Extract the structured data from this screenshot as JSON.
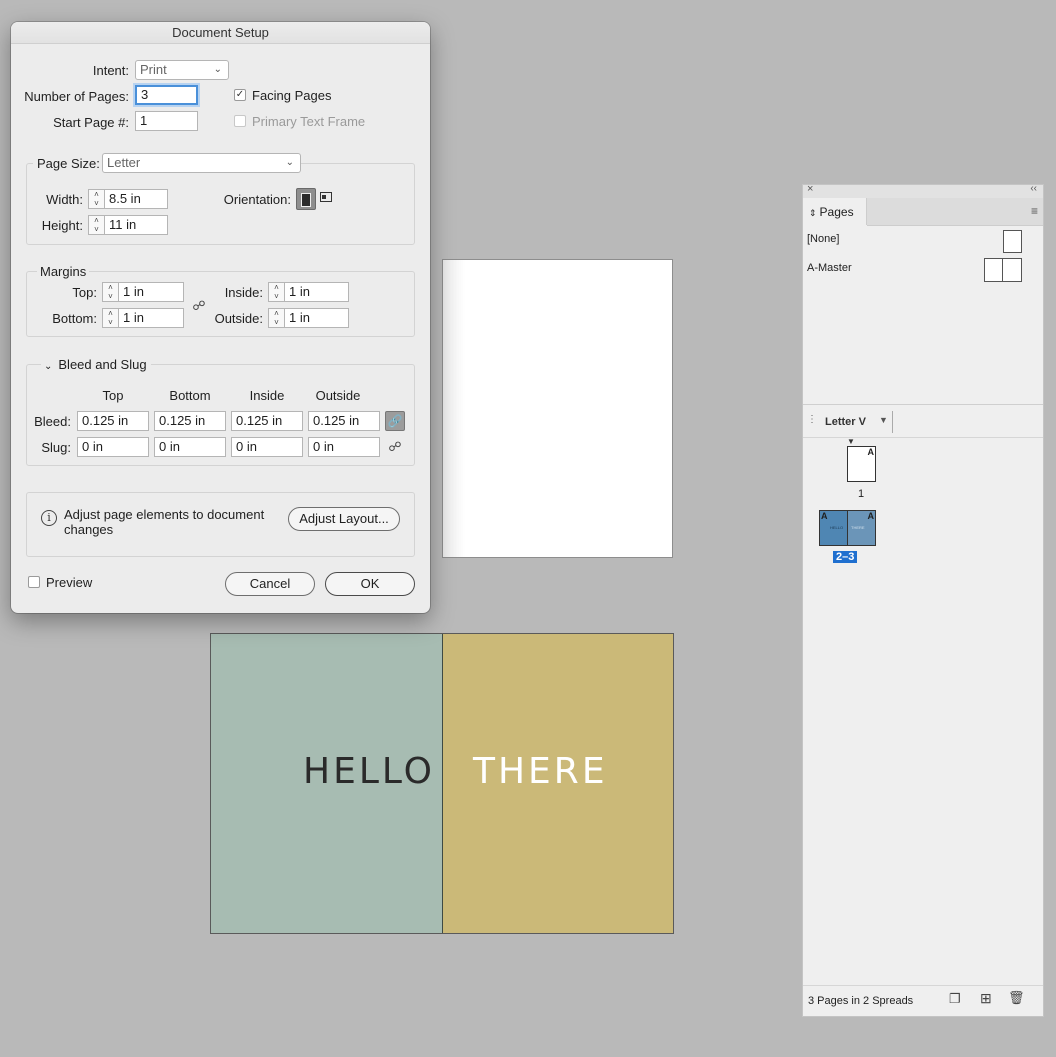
{
  "dialog": {
    "title": "Document Setup",
    "intent_label": "Intent:",
    "intent_value": "Print",
    "num_pages_label": "Number of Pages:",
    "num_pages_value": "3",
    "start_page_label": "Start Page #:",
    "start_page_value": "1",
    "facing_pages_label": "Facing Pages",
    "facing_pages_checked": true,
    "primary_text_frame_label": "Primary Text Frame",
    "page_size_label": "Page Size:",
    "page_size_value": "Letter",
    "width_label": "Width:",
    "width_value": "8.5 in",
    "height_label": "Height:",
    "height_value": "11 in",
    "orientation_label": "Orientation:",
    "margins_title": "Margins",
    "top_label": "Top:",
    "top_value": "1 in",
    "bottom_label": "Bottom:",
    "bottom_value": "1 in",
    "inside_label": "Inside:",
    "inside_value": "1 in",
    "outside_label": "Outside:",
    "outside_value": "1 in",
    "bleed_slug_title": "Bleed and Slug",
    "columns": [
      "Top",
      "Bottom",
      "Inside",
      "Outside"
    ],
    "bleed_label": "Bleed:",
    "bleed_values": [
      "0.125 in",
      "0.125 in",
      "0.125 in",
      "0.125 in"
    ],
    "slug_label": "Slug:",
    "slug_values": [
      "0 in",
      "0 in",
      "0 in",
      "0 in"
    ],
    "adjust_text": "Adjust page elements to document changes",
    "adjust_button": "Adjust Layout...",
    "preview_label": "Preview",
    "cancel_button": "Cancel",
    "ok_button": "OK"
  },
  "canvas": {
    "hello_text": "HELLO",
    "there_text": "THERE",
    "left_color": "#a7bcb2",
    "right_color": "#cbb978"
  },
  "pages_panel": {
    "tab_label": "Pages",
    "none_label": "[None]",
    "master_label": "A-Master",
    "view_label": "Letter V",
    "page1_number": "1",
    "spread_numbers": "2–3",
    "master_letter": "A",
    "thumb_text_left": "HELLO",
    "thumb_text_right": "THERE",
    "status": "3 Pages in 2 Spreads"
  }
}
